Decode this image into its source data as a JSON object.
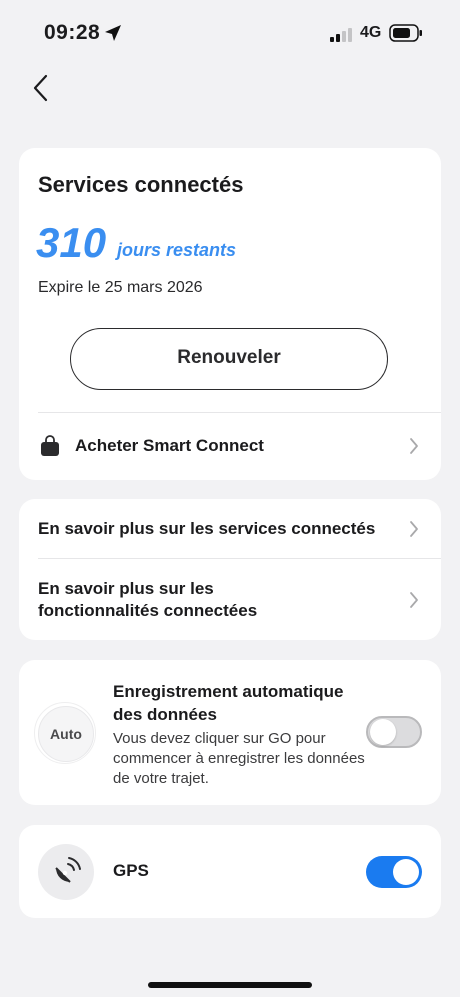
{
  "status": {
    "time": "09:28",
    "network": "4G"
  },
  "subscription": {
    "title": "Services connectés",
    "days_remaining": "310",
    "days_label": "jours restants",
    "expiry": "Expire le 25 mars 2026",
    "renew_label": "Renouveler",
    "buy_label": "Acheter Smart Connect"
  },
  "info_links": [
    "En savoir plus sur les services connectés",
    "En savoir plus sur les fonctionnalités connectées"
  ],
  "auto_record": {
    "badge": "Auto",
    "title": "Enregistrement automatique des données",
    "description": "Vous devez cliquer sur GO pour commencer à enregistrer les données de votre trajet.",
    "enabled": false
  },
  "gps": {
    "label": "GPS",
    "enabled": true
  },
  "colors": {
    "accent": "#3a8ef0",
    "toggle_on": "#1a7bf0",
    "background": "#f2f2f4"
  }
}
